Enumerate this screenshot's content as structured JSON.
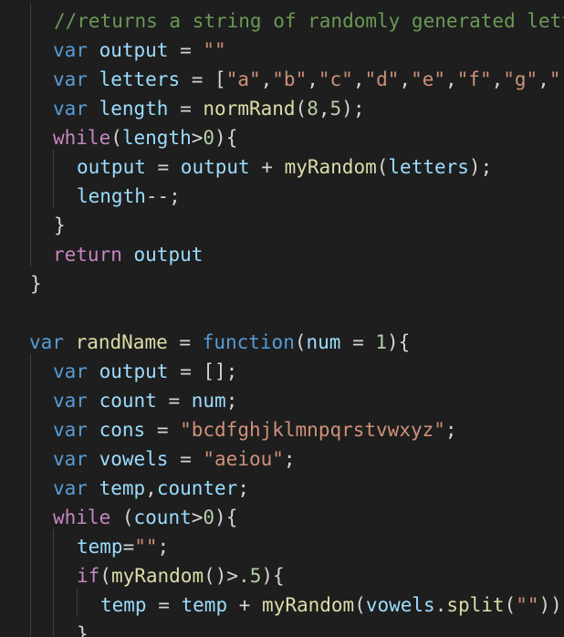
{
  "editor": {
    "language": "javascript",
    "theme": "dark",
    "colors": {
      "background": "#1e1e1e",
      "default": "#d4d4d4",
      "comment": "#6a9955",
      "keyword": "#569cd6",
      "control": "#c586c0",
      "variable": "#9cdcfe",
      "function": "#dcdcaa",
      "string": "#ce9178",
      "number": "#b5cea8",
      "indent_guide": "#404040"
    },
    "lines": [
      [
        [
          "cmt",
          "//returns a string of randomly generated letters"
        ]
      ],
      [
        [
          "kw",
          "var"
        ],
        [
          "op",
          " "
        ],
        [
          "var",
          "output"
        ],
        [
          "op",
          " = "
        ],
        [
          "str",
          "\"\""
        ]
      ],
      [
        [
          "kw",
          "var"
        ],
        [
          "op",
          " "
        ],
        [
          "var",
          "letters"
        ],
        [
          "op",
          " = ["
        ],
        [
          "str",
          "\"a\""
        ],
        [
          "op",
          ","
        ],
        [
          "str",
          "\"b\""
        ],
        [
          "op",
          ","
        ],
        [
          "str",
          "\"c\""
        ],
        [
          "op",
          ","
        ],
        [
          "str",
          "\"d\""
        ],
        [
          "op",
          ","
        ],
        [
          "str",
          "\"e\""
        ],
        [
          "op",
          ","
        ],
        [
          "str",
          "\"f\""
        ],
        [
          "op",
          ","
        ],
        [
          "str",
          "\"g\""
        ],
        [
          "op",
          ","
        ],
        [
          "str",
          "\""
        ]
      ],
      [
        [
          "kw",
          "var"
        ],
        [
          "op",
          " "
        ],
        [
          "var",
          "length"
        ],
        [
          "op",
          " = "
        ],
        [
          "fn",
          "normRand"
        ],
        [
          "op",
          "("
        ],
        [
          "num",
          "8"
        ],
        [
          "op",
          ","
        ],
        [
          "num",
          "5"
        ],
        [
          "op",
          ");"
        ]
      ],
      [
        [
          "ctl",
          "while"
        ],
        [
          "op",
          "("
        ],
        [
          "var",
          "length"
        ],
        [
          "op",
          ">"
        ],
        [
          "num",
          "0"
        ],
        [
          "op",
          "){"
        ]
      ],
      [
        [
          "var",
          "output"
        ],
        [
          "op",
          " = "
        ],
        [
          "var",
          "output"
        ],
        [
          "op",
          " + "
        ],
        [
          "fn",
          "myRandom"
        ],
        [
          "op",
          "("
        ],
        [
          "var",
          "letters"
        ],
        [
          "op",
          ");"
        ]
      ],
      [
        [
          "var",
          "length"
        ],
        [
          "op",
          "--;"
        ]
      ],
      [
        [
          "op",
          "}"
        ]
      ],
      [
        [
          "ctl",
          "return"
        ],
        [
          "op",
          " "
        ],
        [
          "var",
          "output"
        ]
      ],
      [
        [
          "op",
          "}"
        ]
      ],
      [],
      [
        [
          "kw",
          "var"
        ],
        [
          "op",
          " "
        ],
        [
          "fn",
          "randName"
        ],
        [
          "op",
          " = "
        ],
        [
          "kw",
          "function"
        ],
        [
          "op",
          "("
        ],
        [
          "var",
          "num"
        ],
        [
          "op",
          " = "
        ],
        [
          "num",
          "1"
        ],
        [
          "op",
          "){"
        ]
      ],
      [
        [
          "kw",
          "var"
        ],
        [
          "op",
          " "
        ],
        [
          "var",
          "output"
        ],
        [
          "op",
          " = [];"
        ]
      ],
      [
        [
          "kw",
          "var"
        ],
        [
          "op",
          " "
        ],
        [
          "var",
          "count"
        ],
        [
          "op",
          " = "
        ],
        [
          "var",
          "num"
        ],
        [
          "op",
          ";"
        ]
      ],
      [
        [
          "kw",
          "var"
        ],
        [
          "op",
          " "
        ],
        [
          "var",
          "cons"
        ],
        [
          "op",
          " = "
        ],
        [
          "str",
          "\"bcdfghjklmnpqrstvwxyz\""
        ],
        [
          "op",
          ";"
        ]
      ],
      [
        [
          "kw",
          "var"
        ],
        [
          "op",
          " "
        ],
        [
          "var",
          "vowels"
        ],
        [
          "op",
          " = "
        ],
        [
          "str",
          "\"aeiou\""
        ],
        [
          "op",
          ";"
        ]
      ],
      [
        [
          "kw",
          "var"
        ],
        [
          "op",
          " "
        ],
        [
          "var",
          "temp"
        ],
        [
          "op",
          ","
        ],
        [
          "var",
          "counter"
        ],
        [
          "op",
          ";"
        ]
      ],
      [
        [
          "ctl",
          "while"
        ],
        [
          "op",
          " ("
        ],
        [
          "var",
          "count"
        ],
        [
          "op",
          ">"
        ],
        [
          "num",
          "0"
        ],
        [
          "op",
          "){"
        ]
      ],
      [
        [
          "var",
          "temp"
        ],
        [
          "op",
          "="
        ],
        [
          "str",
          "\"\""
        ],
        [
          "op",
          ";"
        ]
      ],
      [
        [
          "ctl",
          "if"
        ],
        [
          "op",
          "("
        ],
        [
          "fn",
          "myRandom"
        ],
        [
          "op",
          "()>"
        ],
        [
          "num",
          ".5"
        ],
        [
          "op",
          "){"
        ]
      ],
      [
        [
          "var",
          "temp"
        ],
        [
          "op",
          " = "
        ],
        [
          "var",
          "temp"
        ],
        [
          "op",
          " + "
        ],
        [
          "fn",
          "myRandom"
        ],
        [
          "op",
          "("
        ],
        [
          "var",
          "vowels"
        ],
        [
          "op",
          "."
        ],
        [
          "fn",
          "split"
        ],
        [
          "op",
          "("
        ],
        [
          "str",
          "\"\""
        ],
        [
          "op",
          "))"
        ]
      ],
      [
        [
          "op",
          "}"
        ]
      ]
    ]
  }
}
